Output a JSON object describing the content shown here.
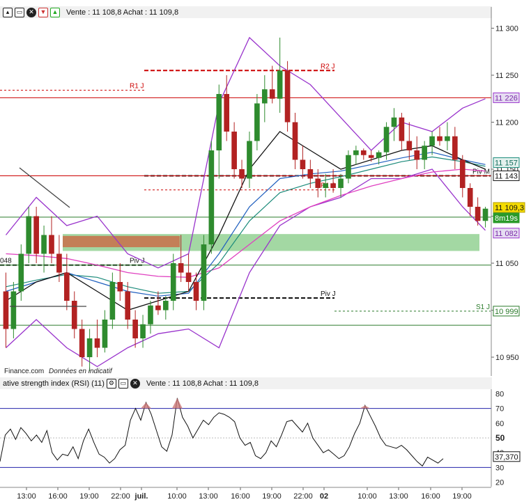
{
  "toolbar_main": {
    "quote_text": "Vente : 11 108,8 Achat : 11 109,8"
  },
  "toolbar_rsi": {
    "indicator_label": "ative strength index (RSI) (11)",
    "quote_text": "Vente : 11 108,8 Achat : 11 109,8"
  },
  "footer_text": {
    "source": "Finance.com",
    "disclaimer": "Données en indicatif"
  },
  "colors": {
    "up": "#2e8b2e",
    "down": "#b22222",
    "bollinger": "#9933cc",
    "ma_black": "#111111",
    "ma_blue": "#1f5fbf",
    "ma_teal": "#1a8a7a",
    "ma_magenta": "#e040c0",
    "support_zone": "#7cc87c",
    "resistance_zone": "#c9704a",
    "rsi_line": "#111111",
    "rsi_band": "#2222aa",
    "pivot": "#111111"
  },
  "chart_data": [
    {
      "type": "candlestick",
      "instrument_quote": "Vente : 11 108,8 Achat : 11 109,8",
      "x_tick_labels": [
        "13:00",
        "16:00",
        "19:00",
        "22:00",
        "juil.",
        "10:00",
        "13:00",
        "16:00",
        "19:00",
        "22:00",
        "02",
        "10:00",
        "13:00",
        "16:00",
        "19:00"
      ],
      "y_tick_labels": [
        "11 300",
        "11 250",
        "11 200",
        "11 150",
        "11 100",
        "11 050",
        "11 000",
        "10 950"
      ],
      "ylim": [
        10930,
        11310
      ],
      "price_badges": [
        {
          "label": "11 226",
          "value": 11226,
          "style": "bollinger"
        },
        {
          "label": "11 157",
          "value": 11157,
          "style": "ma"
        },
        {
          "label": "11 143",
          "value": 11143,
          "style": "pivot"
        },
        {
          "label": "11 109,3",
          "value": 11109.3,
          "style": "last"
        },
        {
          "label": "8m19s",
          "value": 11100,
          "style": "timer"
        },
        {
          "label": "11 082",
          "value": 11082,
          "style": "bollinger"
        },
        {
          "label": "10 999",
          "value": 10999,
          "style": "support"
        }
      ],
      "levels": [
        {
          "label": "R2 J",
          "value": 11255
        },
        {
          "label": "R1 J",
          "value": 11234
        },
        {
          "label": "R1 J",
          "value": 11128
        },
        {
          "label": "Piv J",
          "value": 11048
        },
        {
          "label": "Piv J",
          "value": 11013
        },
        {
          "label": "Piv M",
          "value": 11143
        },
        {
          "label": "S1 J",
          "value": 10999
        }
      ],
      "partial_labels": [
        {
          "label": "048",
          "value": 11048
        }
      ],
      "zones": [
        {
          "type": "support",
          "from": 11063,
          "to": 11081
        },
        {
          "type": "resistance",
          "from": 11067,
          "to": 11079
        }
      ],
      "candles": [
        {
          "o": 11020,
          "h": 11040,
          "l": 10960,
          "c": 10980
        },
        {
          "o": 10980,
          "h": 11030,
          "l": 10970,
          "c": 11020
        },
        {
          "o": 11020,
          "h": 11070,
          "l": 11010,
          "c": 11060
        },
        {
          "o": 11060,
          "h": 11110,
          "l": 11050,
          "c": 11100
        },
        {
          "o": 11100,
          "h": 11110,
          "l": 11050,
          "c": 11060
        },
        {
          "o": 11060,
          "h": 11090,
          "l": 11040,
          "c": 11080
        },
        {
          "o": 11080,
          "h": 11100,
          "l": 11050,
          "c": 11060
        },
        {
          "o": 11060,
          "h": 11080,
          "l": 11030,
          "c": 11040
        },
        {
          "o": 11040,
          "h": 11060,
          "l": 11000,
          "c": 11010
        },
        {
          "o": 11010,
          "h": 11020,
          "l": 10970,
          "c": 10980
        },
        {
          "o": 10980,
          "h": 10990,
          "l": 10940,
          "c": 10950
        },
        {
          "o": 10950,
          "h": 10980,
          "l": 10935,
          "c": 10970
        },
        {
          "o": 10970,
          "h": 10990,
          "l": 10950,
          "c": 10960
        },
        {
          "o": 10960,
          "h": 11000,
          "l": 10955,
          "c": 10990
        },
        {
          "o": 10990,
          "h": 11040,
          "l": 10980,
          "c": 11030
        },
        {
          "o": 11030,
          "h": 11050,
          "l": 11010,
          "c": 11020
        },
        {
          "o": 11020,
          "h": 11030,
          "l": 10980,
          "c": 10990
        },
        {
          "o": 10990,
          "h": 11000,
          "l": 10960,
          "c": 10970
        },
        {
          "o": 10970,
          "h": 10995,
          "l": 10960,
          "c": 10985
        },
        {
          "o": 10985,
          "h": 11010,
          "l": 10975,
          "c": 11005
        },
        {
          "o": 11005,
          "h": 11020,
          "l": 10995,
          "c": 11000
        },
        {
          "o": 11000,
          "h": 11015,
          "l": 10990,
          "c": 11010
        },
        {
          "o": 11010,
          "h": 11060,
          "l": 11000,
          "c": 11050
        },
        {
          "o": 11050,
          "h": 11080,
          "l": 11030,
          "c": 11040
        },
        {
          "o": 11040,
          "h": 11060,
          "l": 11020,
          "c": 11030
        },
        {
          "o": 11030,
          "h": 11040,
          "l": 11000,
          "c": 11010
        },
        {
          "o": 11010,
          "h": 11080,
          "l": 11000,
          "c": 11070
        },
        {
          "o": 11070,
          "h": 11180,
          "l": 11060,
          "c": 11170
        },
        {
          "o": 11170,
          "h": 11240,
          "l": 11140,
          "c": 11230
        },
        {
          "o": 11230,
          "h": 11250,
          "l": 11180,
          "c": 11190
        },
        {
          "o": 11190,
          "h": 11200,
          "l": 11140,
          "c": 11150
        },
        {
          "o": 11150,
          "h": 11160,
          "l": 11130,
          "c": 11140
        },
        {
          "o": 11140,
          "h": 11190,
          "l": 11130,
          "c": 11180
        },
        {
          "o": 11180,
          "h": 11230,
          "l": 11170,
          "c": 11220
        },
        {
          "o": 11220,
          "h": 11250,
          "l": 11200,
          "c": 11235
        },
        {
          "o": 11235,
          "h": 11260,
          "l": 11220,
          "c": 11225
        },
        {
          "o": 11225,
          "h": 11290,
          "l": 11210,
          "c": 11255
        },
        {
          "o": 11255,
          "h": 11265,
          "l": 11190,
          "c": 11200
        },
        {
          "o": 11200,
          "h": 11210,
          "l": 11150,
          "c": 11160
        },
        {
          "o": 11160,
          "h": 11175,
          "l": 11140,
          "c": 11150
        },
        {
          "o": 11150,
          "h": 11160,
          "l": 11130,
          "c": 11140
        },
        {
          "o": 11140,
          "h": 11150,
          "l": 11120,
          "c": 11130
        },
        {
          "o": 11130,
          "h": 11145,
          "l": 11120,
          "c": 11135
        },
        {
          "o": 11135,
          "h": 11150,
          "l": 11125,
          "c": 11130
        },
        {
          "o": 11130,
          "h": 11145,
          "l": 11120,
          "c": 11140
        },
        {
          "o": 11140,
          "h": 11170,
          "l": 11135,
          "c": 11165
        },
        {
          "o": 11165,
          "h": 11175,
          "l": 11155,
          "c": 11170
        },
        {
          "o": 11170,
          "h": 11172,
          "l": 11160,
          "c": 11165
        },
        {
          "o": 11165,
          "h": 11170,
          "l": 11158,
          "c": 11162
        },
        {
          "o": 11162,
          "h": 11170,
          "l": 11155,
          "c": 11168
        },
        {
          "o": 11168,
          "h": 11200,
          "l": 11160,
          "c": 11195
        },
        {
          "o": 11195,
          "h": 11215,
          "l": 11180,
          "c": 11205
        },
        {
          "o": 11205,
          "h": 11210,
          "l": 11170,
          "c": 11180
        },
        {
          "o": 11180,
          "h": 11200,
          "l": 11160,
          "c": 11170
        },
        {
          "o": 11170,
          "h": 11185,
          "l": 11150,
          "c": 11160
        },
        {
          "o": 11160,
          "h": 11180,
          "l": 11150,
          "c": 11175
        },
        {
          "o": 11175,
          "h": 11190,
          "l": 11165,
          "c": 11185
        },
        {
          "o": 11185,
          "h": 11195,
          "l": 11175,
          "c": 11180
        },
        {
          "o": 11180,
          "h": 11200,
          "l": 11170,
          "c": 11185
        },
        {
          "o": 11185,
          "h": 11195,
          "l": 11150,
          "c": 11160
        },
        {
          "o": 11160,
          "h": 11165,
          "l": 11120,
          "c": 11130
        },
        {
          "o": 11130,
          "h": 11135,
          "l": 11100,
          "c": 11110
        },
        {
          "o": 11110,
          "h": 11120,
          "l": 11090,
          "c": 11095
        },
        {
          "o": 11095,
          "h": 11110,
          "l": 11088,
          "c": 11108
        }
      ],
      "bollinger_upper": [
        [
          0,
          11080
        ],
        [
          4,
          11120
        ],
        [
          8,
          11090
        ],
        [
          12,
          11100
        ],
        [
          16,
          11060
        ],
        [
          20,
          11045
        ],
        [
          24,
          11060
        ],
        [
          28,
          11220
        ],
        [
          32,
          11290
        ],
        [
          36,
          11260
        ],
        [
          40,
          11240
        ],
        [
          44,
          11205
        ],
        [
          48,
          11170
        ],
        [
          52,
          11200
        ],
        [
          56,
          11190
        ],
        [
          60,
          11215
        ],
        [
          63,
          11225
        ]
      ],
      "bollinger_lower": [
        [
          0,
          10960
        ],
        [
          4,
          10990
        ],
        [
          8,
          10960
        ],
        [
          12,
          10940
        ],
        [
          16,
          10960
        ],
        [
          20,
          10975
        ],
        [
          24,
          10980
        ],
        [
          28,
          10960
        ],
        [
          32,
          11040
        ],
        [
          36,
          11090
        ],
        [
          40,
          11110
        ],
        [
          44,
          11120
        ],
        [
          48,
          11140
        ],
        [
          52,
          11140
        ],
        [
          56,
          11150
        ],
        [
          60,
          11110
        ],
        [
          63,
          11085
        ]
      ],
      "ma_black": [
        [
          0,
          11010
        ],
        [
          4,
          11030
        ],
        [
          8,
          11040
        ],
        [
          12,
          11020
        ],
        [
          16,
          11000
        ],
        [
          20,
          11010
        ],
        [
          24,
          11020
        ],
        [
          28,
          11080
        ],
        [
          32,
          11150
        ],
        [
          36,
          11190
        ],
        [
          40,
          11170
        ],
        [
          44,
          11150
        ],
        [
          48,
          11160
        ],
        [
          52,
          11170
        ],
        [
          56,
          11175
        ],
        [
          60,
          11160
        ],
        [
          63,
          11150
        ]
      ],
      "ma_blue": [
        [
          0,
          11020
        ],
        [
          4,
          11030
        ],
        [
          8,
          11040
        ],
        [
          12,
          11030
        ],
        [
          16,
          11020
        ],
        [
          20,
          11015
        ],
        [
          24,
          11018
        ],
        [
          28,
          11060
        ],
        [
          32,
          11110
        ],
        [
          36,
          11140
        ],
        [
          40,
          11145
        ],
        [
          44,
          11148
        ],
        [
          48,
          11155
        ],
        [
          52,
          11162
        ],
        [
          56,
          11168
        ],
        [
          60,
          11160
        ],
        [
          63,
          11155
        ]
      ],
      "ma_teal": [
        [
          0,
          11025
        ],
        [
          4,
          11032
        ],
        [
          8,
          11038
        ],
        [
          12,
          11035
        ],
        [
          16,
          11025
        ],
        [
          20,
          11018
        ],
        [
          24,
          11020
        ],
        [
          28,
          11050
        ],
        [
          32,
          11095
        ],
        [
          36,
          11125
        ],
        [
          40,
          11135
        ],
        [
          44,
          11142
        ],
        [
          48,
          11150
        ],
        [
          52,
          11158
        ],
        [
          56,
          11163
        ],
        [
          60,
          11158
        ],
        [
          63,
          11153
        ]
      ],
      "ma_magenta": [
        [
          0,
          11060
        ],
        [
          4,
          11058
        ],
        [
          8,
          11055
        ],
        [
          12,
          11048
        ],
        [
          16,
          11040
        ],
        [
          20,
          11036
        ],
        [
          24,
          11035
        ],
        [
          28,
          11045
        ],
        [
          32,
          11070
        ],
        [
          36,
          11095
        ],
        [
          40,
          11110
        ],
        [
          44,
          11122
        ],
        [
          48,
          11132
        ],
        [
          52,
          11140
        ],
        [
          56,
          11147
        ],
        [
          60,
          11150
        ],
        [
          63,
          11148
        ]
      ]
    },
    {
      "type": "line",
      "title": "ative strength index (RSI) (11)",
      "y_tick_labels": [
        "80",
        "70",
        "60",
        "50",
        "40",
        "30",
        "20"
      ],
      "ylim": [
        17,
        83
      ],
      "bands": [
        70,
        30
      ],
      "midline": 50,
      "last_value_label": "37,370",
      "last_value": 37.37,
      "values": [
        34,
        52,
        56,
        49,
        57,
        53,
        48,
        52,
        47,
        55,
        40,
        35,
        39,
        38,
        44,
        36,
        48,
        56,
        47,
        39,
        37,
        33,
        36,
        42,
        45,
        62,
        70,
        62,
        74,
        66,
        55,
        44,
        41,
        52,
        77,
        64,
        58,
        50,
        56,
        62,
        59,
        64,
        67,
        66,
        64,
        61,
        50,
        45,
        47,
        38,
        36,
        40,
        48,
        44,
        52,
        61,
        62,
        58,
        54,
        60,
        50,
        45,
        40,
        42,
        39,
        36,
        38,
        44,
        53,
        60,
        72,
        65,
        58,
        50,
        45,
        44,
        43,
        45,
        42,
        38,
        34,
        31,
        37,
        35,
        33,
        36
      ]
    }
  ]
}
